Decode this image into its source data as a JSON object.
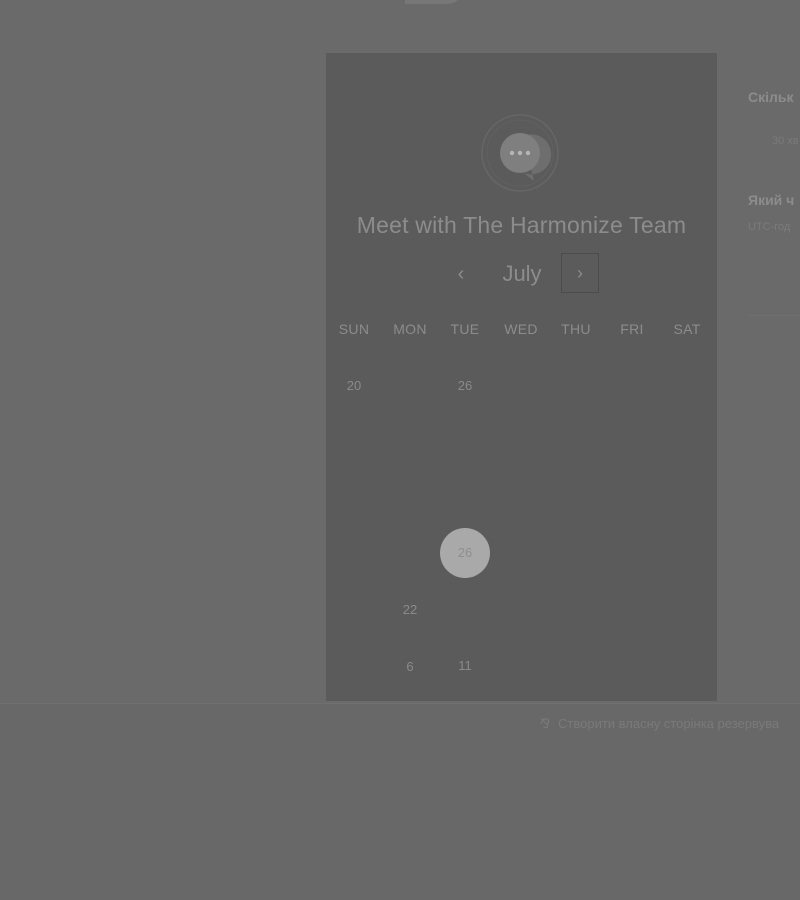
{
  "card": {
    "title": "Meet with The Harmonize Team",
    "avatar_icon": "chat-bubble-icon",
    "month": "July",
    "prev_icon": "chevron-left-icon",
    "next_icon": "chevron-right-icon",
    "prev_glyph": "‹",
    "next_glyph": "›",
    "weekdays": [
      "SUN",
      "MON",
      "TUE",
      "WED",
      "THU",
      "FRI",
      "SAT"
    ],
    "days": {
      "r1_sun": "20",
      "r1_tue": "26",
      "r4_tue_selected": "26",
      "r5_mon": "22",
      "r6_mon": "6",
      "r6_tue": "11"
    }
  },
  "side": {
    "q1": "Скільк",
    "a1": "30 хв",
    "q2": "Який ч",
    "a2": "UTC-год"
  },
  "footer": {
    "create_link": "Створити власну сторінка резервува",
    "create_icon": "scheduling-link-icon",
    "create_glyph": "⅋"
  },
  "colors": {
    "overlay": "#6a6a6a",
    "card": "#5b5b5b",
    "selected_day": "#a9a9a9"
  }
}
